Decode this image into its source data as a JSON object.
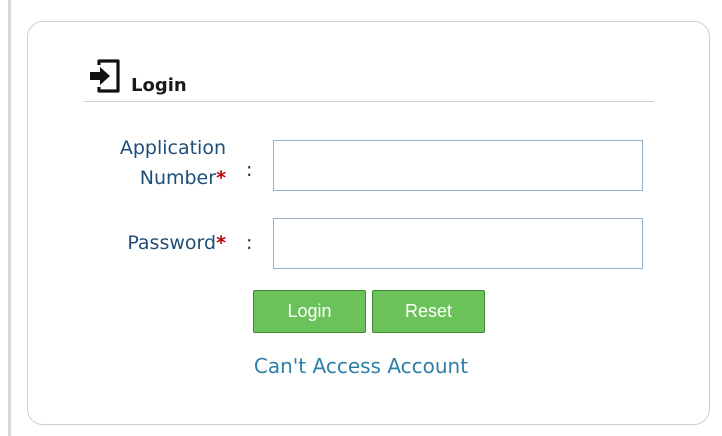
{
  "login_panel": {
    "title": "Login",
    "title_icon": "sign-in-icon"
  },
  "form": {
    "application_number": {
      "label_line1": "Application",
      "label_line2": "Number",
      "required_marker": "*",
      "separator": ":",
      "value": ""
    },
    "password": {
      "label": "Password",
      "required_marker": "*",
      "separator": ":",
      "value": ""
    }
  },
  "buttons": {
    "login_label": "Login",
    "reset_label": "Reset"
  },
  "links": {
    "cant_access": "Can't Access Account"
  },
  "colors": {
    "button_green": "#6cc25a",
    "label_blue": "#1f4e79",
    "required_red": "#c00000",
    "link_blue": "#2e7fa8"
  }
}
